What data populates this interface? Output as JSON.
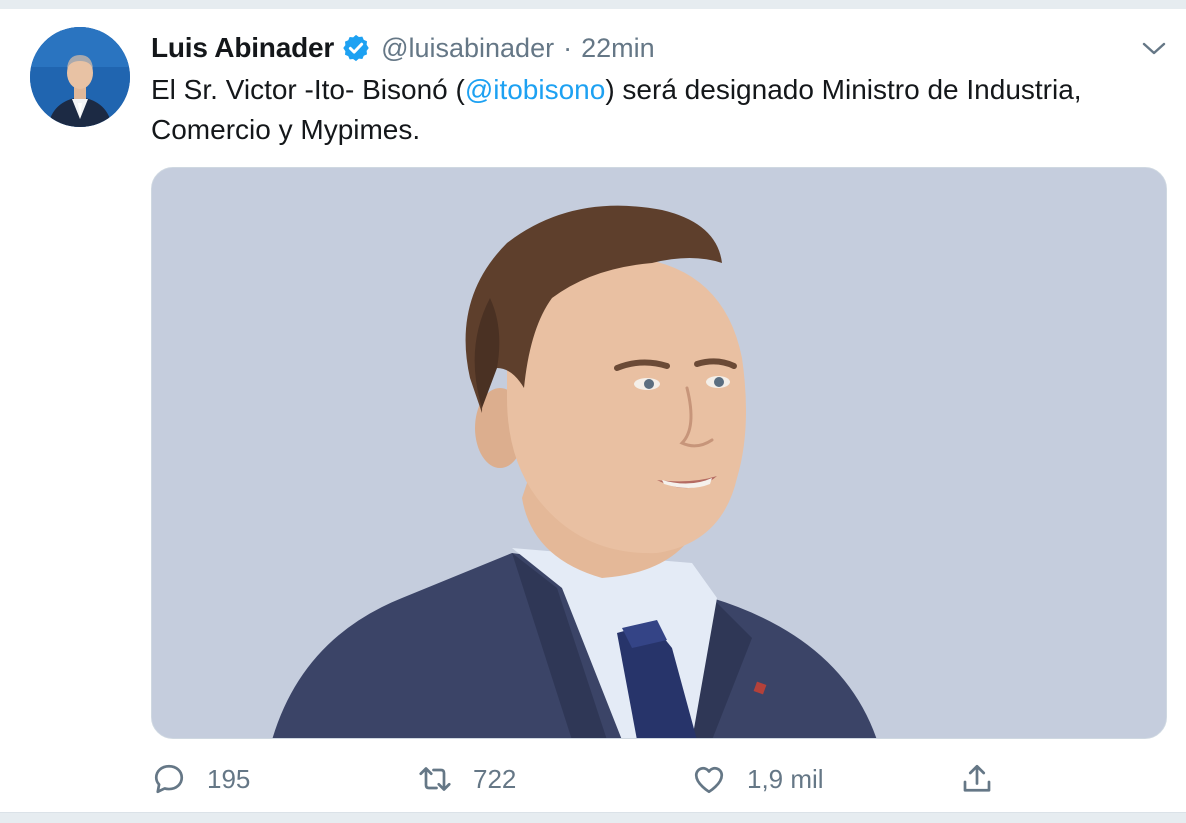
{
  "tweet": {
    "author": {
      "display_name": "Luis Abinader",
      "handle": "@luisabinader",
      "verified": true,
      "avatar_icon": "profile-photo"
    },
    "separator": "·",
    "time": "22min",
    "text_before": "El Sr. Victor -Ito- Bisonó (",
    "mention": "@itobisono",
    "text_after": ") será designado Ministro de Industria, Comercio y Mypimes.",
    "media_icon": "photo"
  },
  "actions": {
    "reply": {
      "icon": "reply-icon",
      "count": "195"
    },
    "retweet": {
      "icon": "retweet-icon",
      "count": "722"
    },
    "like": {
      "icon": "heart-icon",
      "count": "1,9 mil"
    },
    "share": {
      "icon": "share-icon"
    }
  },
  "colors": {
    "text": "#14171a",
    "muted": "#657786",
    "link": "#1da1f2",
    "verified": "#1da1f2",
    "media_background": "#c5cddd"
  }
}
